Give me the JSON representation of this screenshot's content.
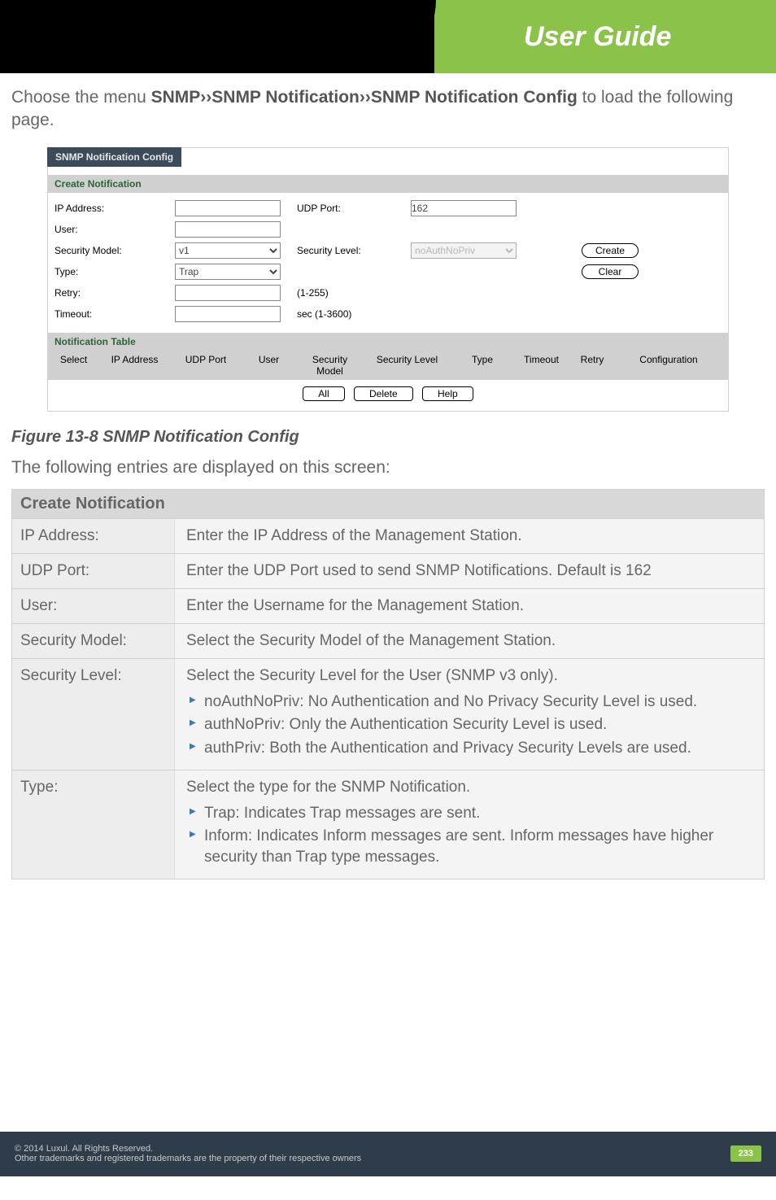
{
  "header": {
    "title": "User Guide"
  },
  "intro": {
    "prefix": "Choose the menu ",
    "bold": "SNMP››SNMP Notification››SNMP Notification Config",
    "suffix": " to load the following page."
  },
  "screenshot": {
    "panel_title": "SNMP Notification Config",
    "create_section": "Create Notification",
    "labels": {
      "ip_address": "IP Address:",
      "udp_port": "UDP Port:",
      "user": "User:",
      "security_model": "Security Model:",
      "security_level": "Security Level:",
      "type": "Type:",
      "retry": "Retry:",
      "timeout": "Timeout:"
    },
    "values": {
      "ip_address": "",
      "udp_port": "162",
      "user": "",
      "security_model": "v1",
      "security_level": "noAuthNoPriv",
      "type": "Trap",
      "retry": "",
      "retry_unit": "(1-255)",
      "timeout": "",
      "timeout_unit": "sec (1-3600)"
    },
    "buttons": {
      "create": "Create",
      "clear": "Clear",
      "all": "All",
      "delete": "Delete",
      "help": "Help"
    },
    "table_section": "Notification Table",
    "table_headers": {
      "select": "Select",
      "ip_address": "IP Address",
      "udp_port": "UDP Port",
      "user": "User",
      "security_model": "Security Model",
      "security_level": "Security Level",
      "type": "Type",
      "timeout": "Timeout",
      "retry": "Retry",
      "configuration": "Configuration"
    }
  },
  "figure_caption": "Figure 13-8 SNMP Notification Config",
  "entries_intro": "The following entries are displayed on this screen:",
  "desc": {
    "header": "Create Notification",
    "rows": [
      {
        "label": "IP Address:",
        "text": "Enter the IP Address of the Management Station."
      },
      {
        "label": "UDP Port:",
        "text": "Enter the UDP Port used to send SNMP Notifications. Default is 162"
      },
      {
        "label": "User:",
        "text": "Enter the Username for the Management Station."
      },
      {
        "label": "Security Model:",
        "text": "Select the Security Model of the Management Station."
      },
      {
        "label": "Security Level:",
        "text": "Select the Security Level for the User (SNMP v3 only).",
        "bullets": [
          "noAuthNoPriv: No Authentication and No Privacy Security Level is used.",
          "authNoPriv: Only the Authentication Security Level is used.",
          "authPriv: Both the Authentication and Privacy Security Levels are used."
        ]
      },
      {
        "label": "Type:",
        "text": "Select the type for the SNMP Notification.",
        "bullets": [
          "Trap: Indicates Trap messages are sent.",
          "Inform: Indicates Inform messages are sent. Inform messages have higher security than Trap type messages."
        ]
      }
    ]
  },
  "footer": {
    "line1": "© 2014  Luxul. All Rights Reserved.",
    "line2": "Other trademarks and registered trademarks are the property of their respective owners",
    "page": "233"
  }
}
